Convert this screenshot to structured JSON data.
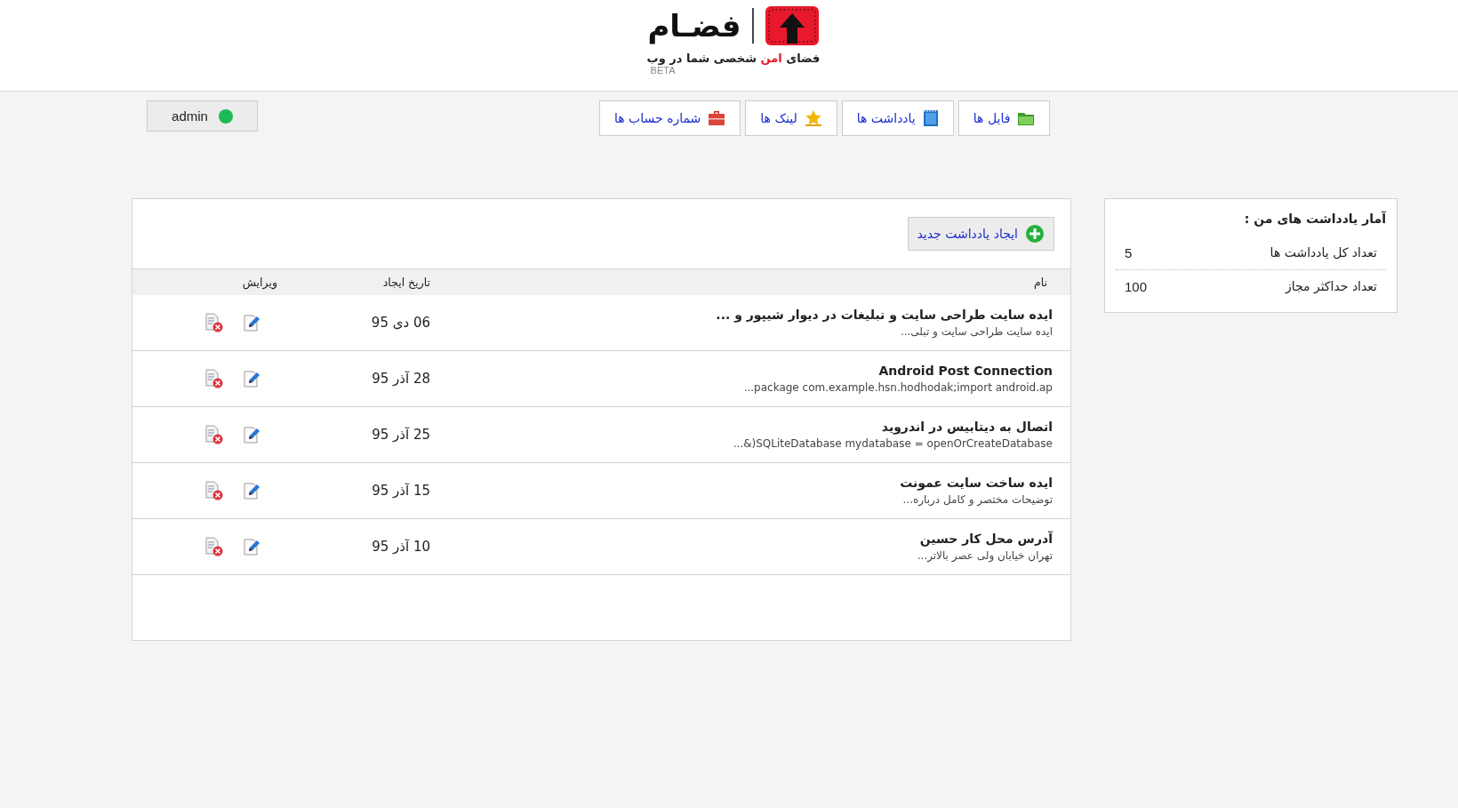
{
  "header": {
    "logo_text": "فضـام",
    "tagline": [
      {
        "text": "فضای ",
        "accent": false
      },
      {
        "text": "امن",
        "accent": true
      },
      {
        "text": " شخصی شما در وب",
        "accent": false
      }
    ],
    "badge": "BETA"
  },
  "user": {
    "name": "admin",
    "online": true
  },
  "nav": [
    {
      "label": "فایل ها",
      "kind": "folder"
    },
    {
      "label": "یادداشت ها",
      "kind": "notebook"
    },
    {
      "label": "لینک ها",
      "kind": "star"
    },
    {
      "label": "شماره حساب ها",
      "kind": "briefcase"
    }
  ],
  "stats": {
    "title": "آمار یادداشت های من :",
    "rows": [
      {
        "label": "تعداد کل یادداشت ها",
        "value": "5"
      },
      {
        "label": "تعداد حداکثر مجاز",
        "value": "100"
      }
    ]
  },
  "notes": {
    "new_button": "ایجاد یادداشت جدید",
    "columns": [
      "نام",
      "تاریخ ایجاد",
      "ویرایش"
    ],
    "rows": [
      {
        "title": "ایده سایت طراحی سایت و تبلیغات در دیوار شیپور و ...",
        "excerpt": "ایده سایت طراحی سایت و تبلی...",
        "date": "06 دی 95"
      },
      {
        "title": "Android Post Connection",
        "excerpt": "package com.example.hsn.hodhodak;import android.ap...",
        "date": "28 آذر 95"
      },
      {
        "title": "اتصال به دیتابیس در اندروید",
        "excerpt": "SQLiteDatabase mydatabase = openOrCreateDatabase(&...",
        "date": "25 آذر 95"
      },
      {
        "title": "ایده ساخت سایت عمونت",
        "excerpt": "توضیحات مختصر و کامل درباره...",
        "date": "15 آذر 95"
      },
      {
        "title": "آدرس محل کار حسین",
        "excerpt": "تهران خیابان ولی عصر بالاتر...",
        "date": "10 آذر 95"
      }
    ]
  }
}
